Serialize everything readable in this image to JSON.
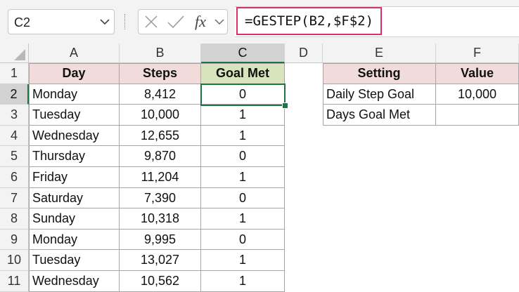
{
  "name_box": {
    "value": "C2"
  },
  "formula_bar": {
    "cancel_icon": "close-icon",
    "enter_icon": "check-icon",
    "fx_label": "fx",
    "formula": "=GESTEP(B2,$F$2)"
  },
  "columns": [
    "A",
    "B",
    "C",
    "D",
    "E",
    "F"
  ],
  "selected_column": "C",
  "rows": [
    "1",
    "2",
    "3",
    "4",
    "5",
    "6",
    "7",
    "8",
    "9",
    "10",
    "11"
  ],
  "selected_row": "2",
  "headers": {
    "day": "Day",
    "steps": "Steps",
    "goal_met": "Goal Met",
    "setting": "Setting",
    "value": "Value"
  },
  "data": [
    {
      "day": "Monday",
      "steps": "8,412",
      "goal": "0"
    },
    {
      "day": "Tuesday",
      "steps": "10,000",
      "goal": "1"
    },
    {
      "day": "Wednesday",
      "steps": "12,655",
      "goal": "1"
    },
    {
      "day": "Thursday",
      "steps": "9,870",
      "goal": "0"
    },
    {
      "day": "Friday",
      "steps": "11,204",
      "goal": "1"
    },
    {
      "day": "Saturday",
      "steps": "7,390",
      "goal": "0"
    },
    {
      "day": "Sunday",
      "steps": "10,318",
      "goal": "1"
    },
    {
      "day": "Monday",
      "steps": "9,995",
      "goal": "0"
    },
    {
      "day": "Tuesday",
      "steps": "13,027",
      "goal": "1"
    },
    {
      "day": "Wednesday",
      "steps": "10,562",
      "goal": "1"
    }
  ],
  "settings": [
    {
      "label": "Daily Step Goal",
      "value": "10,000"
    },
    {
      "label": "Days Goal Met",
      "value": ""
    }
  ],
  "colors": {
    "selection": "#217346",
    "header_fill": "#f2dcdb",
    "goal_header_fill": "#d8e4bc",
    "formula_highlight": "#d6336c"
  }
}
